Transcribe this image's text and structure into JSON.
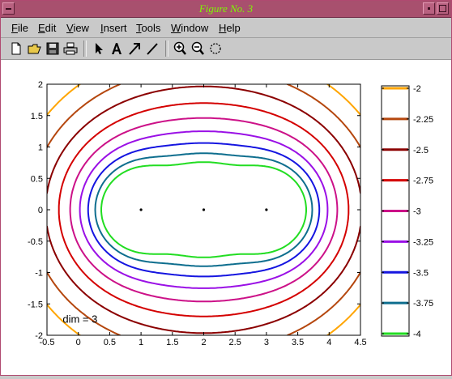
{
  "window": {
    "title": "Figure No. 3",
    "colors": {
      "titlebar": "#a8506e",
      "title_text": "#7cfc00"
    }
  },
  "menu": [
    {
      "label": "File",
      "ul": "F"
    },
    {
      "label": "Edit",
      "ul": "E"
    },
    {
      "label": "View",
      "ul": "V"
    },
    {
      "label": "Insert",
      "ul": "I"
    },
    {
      "label": "Tools",
      "ul": "T"
    },
    {
      "label": "Window",
      "ul": "W"
    },
    {
      "label": "Help",
      "ul": "H"
    }
  ],
  "toolbar": {
    "icons": [
      "new-file-icon",
      "open-folder-icon",
      "save-icon",
      "print-icon",
      "arrow-select-icon",
      "insert-text-icon",
      "insert-arrow-icon",
      "insert-line-icon",
      "zoom-in-icon",
      "zoom-out-icon",
      "rotate-icon"
    ]
  },
  "plot": {
    "annotation": "dim = 3",
    "x_ticks": [
      "-0.5",
      "0",
      "0.5",
      "1",
      "1.5",
      "2",
      "2.5",
      "3",
      "3.5",
      "4",
      "4.5"
    ],
    "y_ticks": [
      "2",
      "1.5",
      "1",
      "0.5",
      "0",
      "-0.5",
      "-1",
      "-1.5",
      "-2"
    ]
  },
  "colorbar": {
    "levels": [
      {
        "label": "-2",
        "color": "#ffa500"
      },
      {
        "label": "-2.25",
        "color": "#b5470e"
      },
      {
        "label": "-2.5",
        "color": "#8b0000"
      },
      {
        "label": "-2.75",
        "color": "#d40000"
      },
      {
        "label": "-3",
        "color": "#cc1188"
      },
      {
        "label": "-3.25",
        "color": "#9a10e6"
      },
      {
        "label": "-3.5",
        "color": "#1515e0"
      },
      {
        "label": "-3.75",
        "color": "#0e6e8e"
      },
      {
        "label": "-4",
        "color": "#22dd22"
      }
    ]
  },
  "chart_data": {
    "type": "contour",
    "title": "",
    "xlabel": "",
    "ylabel": "",
    "xlim": [
      -0.5,
      4.5
    ],
    "ylim": [
      -2,
      2
    ],
    "contour_levels": [
      -2,
      -2.25,
      -2.5,
      -2.75,
      -3,
      -3.25,
      -3.5,
      -3.75,
      -4
    ],
    "singular_points": [
      [
        1,
        0
      ],
      [
        2,
        0
      ],
      [
        3,
        0
      ]
    ],
    "annotation": "dim = 3"
  }
}
